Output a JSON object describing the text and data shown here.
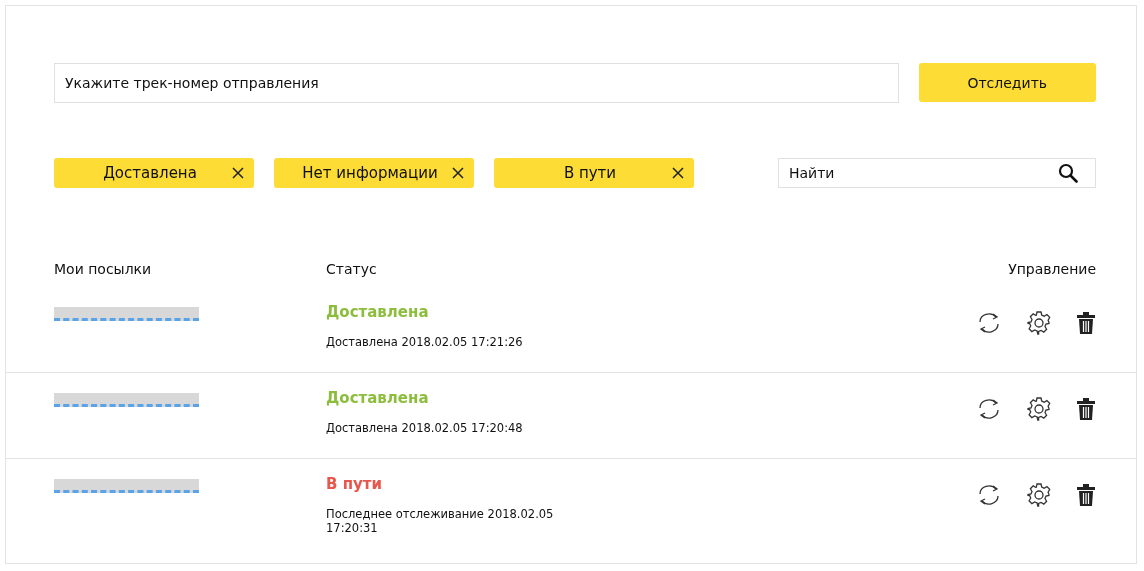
{
  "track_field": {
    "placeholder": "Укажите трек-номер отправления"
  },
  "track_button": "Отследить",
  "filters": [
    {
      "label": "Доставлена"
    },
    {
      "label": "Нет информации"
    },
    {
      "label": "В пути"
    }
  ],
  "search": {
    "placeholder": "Найти"
  },
  "columns": [
    "Мои посылки",
    "Статус",
    "Управление"
  ],
  "parcels": [
    {
      "status": "Доставлена",
      "color": "#8cbd3c",
      "detail": "Доставлена 2018.02.05 17:21:26"
    },
    {
      "status": "Доставлена",
      "color": "#8cbd3c",
      "detail": "Доставлена 2018.02.05 17:20:48"
    },
    {
      "status": "В пути",
      "color": "#e8574c",
      "detail": "Последнее отслеживание 2018.02.05 17:20:31"
    }
  ]
}
